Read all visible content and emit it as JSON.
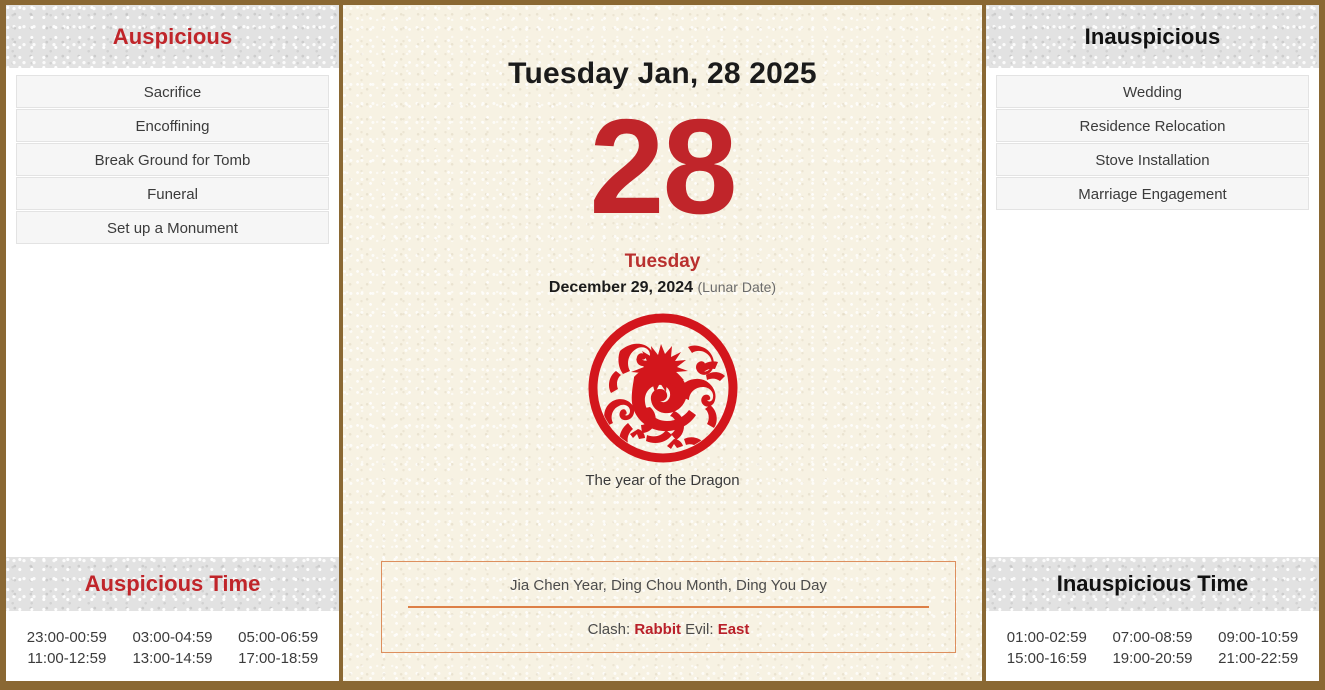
{
  "theme": {
    "frame_color": "#8a6833",
    "accent_red": "#c0252a",
    "accent_orange": "#dd7f46",
    "paper_cream": "#f7f2e3",
    "paper_gray": "#e2e2e2"
  },
  "left_panel": {
    "header": "Auspicious",
    "items": [
      "Sacrifice",
      "Encoffining",
      "Break Ground for Tomb",
      "Funeral",
      "Set up a Monument"
    ],
    "time_header": "Auspicious Time",
    "times": [
      "23:00-00:59",
      "03:00-04:59",
      "05:00-06:59",
      "11:00-12:59",
      "13:00-14:59",
      "17:00-18:59"
    ]
  },
  "right_panel": {
    "header": "Inauspicious",
    "items": [
      "Wedding",
      "Residence Relocation",
      "Stove Installation",
      "Marriage Engagement"
    ],
    "time_header": "Inauspicious Time",
    "times": [
      "01:00-02:59",
      "07:00-08:59",
      "09:00-10:59",
      "15:00-16:59",
      "19:00-20:59",
      "21:00-22:59"
    ]
  },
  "center": {
    "main_date": "Tuesday Jan, 28 2025",
    "day_number": "28",
    "weekday": "Tuesday",
    "lunar_date": "December 29, 2024",
    "lunar_tag": "(Lunar Date)",
    "zodiac_icon": "dragon-papercut-icon",
    "zodiac_caption": "The year of the Dragon",
    "pillars": "Jia Chen Year, Ding Chou Month, Ding You Day",
    "clash_label": "Clash:",
    "clash_value": "Rabbit",
    "evil_label": "Evil:",
    "evil_value": "East"
  }
}
